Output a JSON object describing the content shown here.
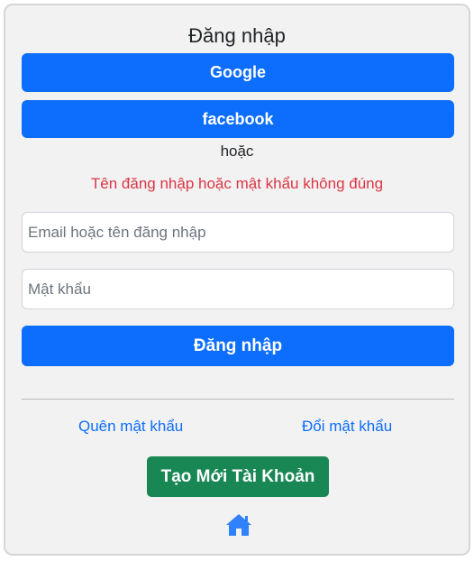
{
  "login": {
    "title": "Đăng nhập",
    "google_label": "Google",
    "facebook_label": "facebook",
    "or_text": "hoặc",
    "error_message": "Tên đăng nhập hoặc mật khẩu không đúng",
    "email_placeholder": "Email hoặc tên đăng nhập",
    "email_value": "",
    "password_placeholder": "Mật khẩu",
    "password_value": "",
    "submit_label": "Đăng nhập",
    "forgot_password_label": "Quên mật khẩu",
    "change_password_label": "Đổi mật khẩu",
    "create_account_label": "Tạo Mới Tài Khoản",
    "home_icon": "home-icon"
  },
  "colors": {
    "primary": "#0d6efd",
    "success": "#198754",
    "danger": "#dc3545",
    "card_background": "#f2f2f2",
    "link_color": "#0d6efd"
  }
}
